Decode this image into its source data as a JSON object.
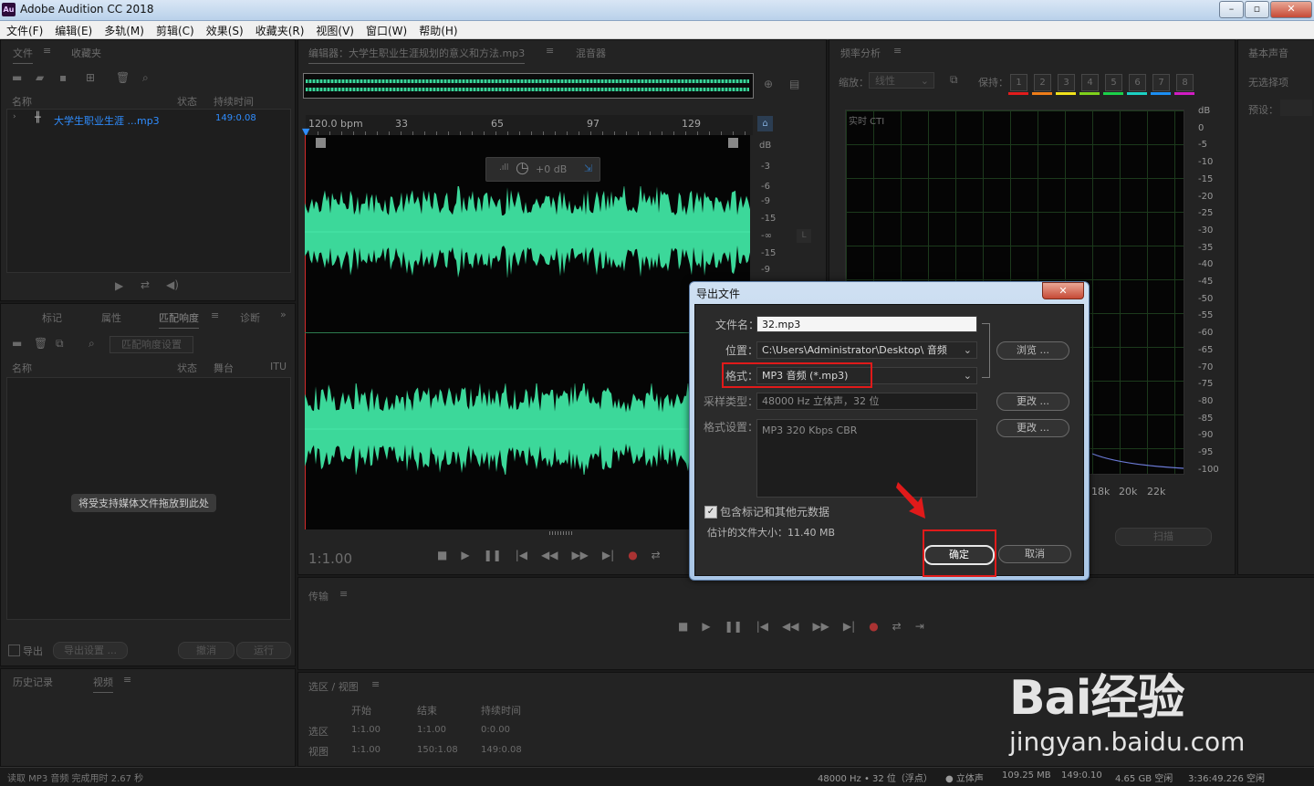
{
  "window": {
    "title": "Adobe Audition CC 2018",
    "app_icon": "Au"
  },
  "menu": [
    "文件(F)",
    "编辑(E)",
    "多轨(M)",
    "剪辑(C)",
    "效果(S)",
    "收藏夹(R)",
    "视图(V)",
    "窗口(W)",
    "帮助(H)"
  ],
  "files_panel": {
    "tabs": [
      "文件",
      "收藏夹"
    ],
    "columns": [
      "名称",
      "状态",
      "持续时间"
    ],
    "file": {
      "name": "大学生职业生涯 ...mp3",
      "duration": "149:0.08"
    }
  },
  "lower_left_panel": {
    "tabs": [
      "标记",
      "属性",
      "匹配响度",
      "诊断"
    ],
    "match_button": "匹配响度设置",
    "columns": [
      "名称",
      "状态",
      "舞台",
      "ITU"
    ],
    "drop_hint": "将受支持媒体文件拖放到此处",
    "export_label": "导出",
    "export_settings": "导出设置 ...",
    "undo": "撤消",
    "run": "运行"
  },
  "history_panel": {
    "tabs": [
      "历史记录",
      "视频"
    ]
  },
  "editor": {
    "tab": "编辑器：大学生职业生涯规划的意义和方法.mp3",
    "mixer_tab": "混音器",
    "ruler": [
      "120.0 bpm",
      "33",
      "65",
      "97",
      "129"
    ],
    "hud_gain": "+0 dB",
    "db_labels": [
      "dB",
      "-3",
      "-6",
      "-9",
      "-15",
      "-∞",
      "-15",
      "-9"
    ],
    "time": "1:1.00",
    "channel_badge": "L"
  },
  "transport_panel": {
    "tab": "传输"
  },
  "selection_panel": {
    "tab": "选区 / 视图",
    "columns": [
      "开始",
      "结束",
      "持续时间"
    ],
    "rows": [
      {
        "label": "选区",
        "start": "1:1.00",
        "end": "1:1.00",
        "duration": "0:0.00"
      },
      {
        "label": "视图",
        "start": "1:1.00",
        "end": "150:1.08",
        "duration": "149:0.08"
      }
    ]
  },
  "frequency_panel": {
    "tab": "频率分析",
    "scale_label": "缩放：",
    "scale_value": "线性",
    "hold_label": "保持：",
    "holds": [
      "1",
      "2",
      "3",
      "4",
      "5",
      "6",
      "7",
      "8"
    ],
    "hold_colors": [
      "#e21c1c",
      "#ef7d19",
      "#f2e21c",
      "#7fd11c",
      "#1cd14a",
      "#1cd1c3",
      "#1c8ef2",
      "#d11cc3"
    ],
    "realtime_label": "实时 CTI",
    "db_ticks": [
      "dB",
      "0",
      "-5",
      "-10",
      "-15",
      "-20",
      "-25",
      "-30",
      "-35",
      "-40",
      "-45",
      "-50",
      "-55",
      "-60",
      "-65",
      "-70",
      "-75",
      "-80",
      "-85",
      "-90",
      "-95",
      "-100"
    ],
    "freq_ticks": [
      "18k",
      "20k",
      "22k"
    ],
    "scan_button": "扫描"
  },
  "essential_panel": {
    "tab": "基本声音",
    "no_selection": "无选择项",
    "preset": "预设："
  },
  "dialog": {
    "title": "导出文件",
    "filename_label": "文件名：",
    "filename": "32.mp3",
    "location_label": "位置：",
    "location": "C:\\Users\\Administrator\\Desktop\\ 音频",
    "browse": "浏览 ...",
    "format_label": "格式：",
    "format": "MP3 音频 (*.mp3)",
    "sample_label": "采样类型：",
    "sample": "48000 Hz 立体声，32 位",
    "change1": "更改 ...",
    "format_settings_label": "格式设置：",
    "format_settings": "MP3 320 Kbps CBR",
    "change2": "更改 ...",
    "include_meta": "包含标记和其他元数据",
    "est_size": "估计的文件大小：11.40 MB",
    "ok": "确定",
    "cancel": "取消"
  },
  "status_bar": {
    "message": "读取 MP3 音频 完成用时 2.67 秒",
    "items": [
      "48000 Hz • 32 位（浮点）",
      "立体声",
      "109.25 MB",
      "149:0.10",
      "4.65 GB 空闲",
      "3:36:49.226 空闲"
    ]
  },
  "watermark": {
    "logo": "Bai经验",
    "url": "jingyan.baidu.com"
  }
}
